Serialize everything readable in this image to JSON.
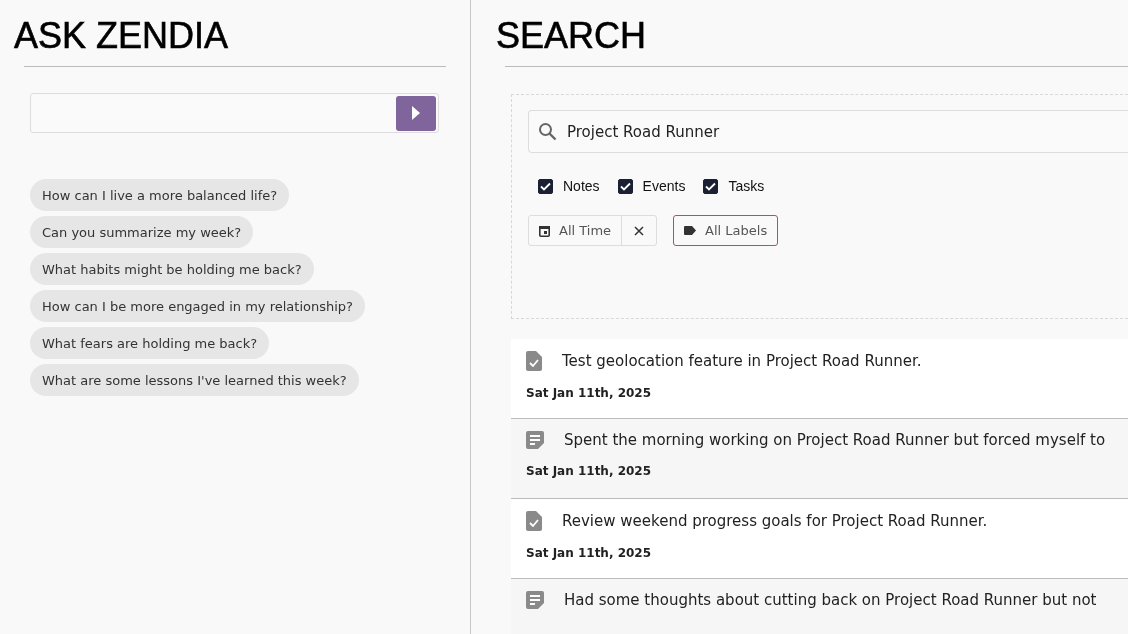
{
  "ask_panel": {
    "title": "ASK ZENDIA",
    "suggestions": [
      "How can I live a more balanced life?",
      "Can you summarize my week?",
      "What habits might be holding me back?",
      "How can I be more engaged in my relationship?",
      "What fears are holding me back?",
      "What are some lessons I've learned this week?"
    ]
  },
  "search_panel": {
    "title": "SEARCH",
    "search_field": {
      "value": "Project Road Runner"
    },
    "filters": [
      {
        "label": "Notes",
        "checked": true
      },
      {
        "label": "Events",
        "checked": true
      },
      {
        "label": "Tasks",
        "checked": true
      }
    ],
    "time_filter": {
      "label": "All Time"
    },
    "label_filter": {
      "label": "All Labels"
    },
    "results": [
      {
        "kind": "task",
        "text": "Test geolocation feature in Project Road Runner.",
        "date": "Sat Jan 11th, 2025"
      },
      {
        "kind": "note",
        "text": "Spent the morning working on Project Road Runner but forced myself to",
        "date": "Sat Jan 11th, 2025"
      },
      {
        "kind": "task",
        "text": "Review weekend progress goals for Project Road Runner.",
        "date": "Sat Jan 11th, 2025"
      },
      {
        "kind": "note",
        "text": "Had some thoughts about cutting back on Project Road Runner but not"
      }
    ]
  }
}
